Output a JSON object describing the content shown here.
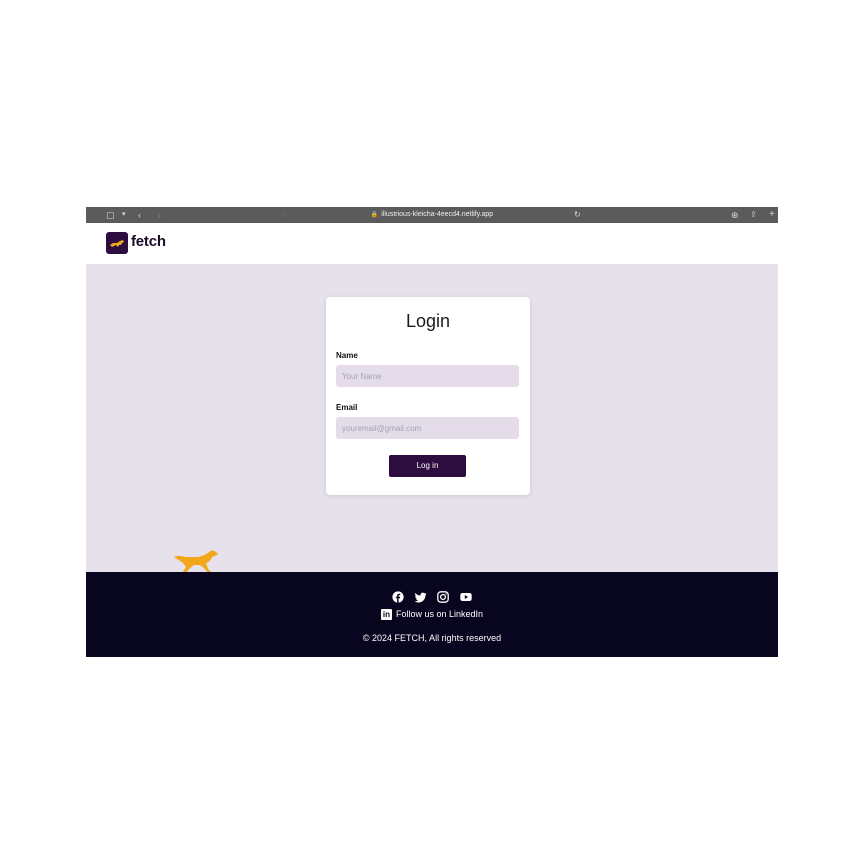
{
  "browser": {
    "url": "illustrious-kleicha-4eecd4.netlify.app"
  },
  "header": {
    "brand": "fetch"
  },
  "login": {
    "title": "Login",
    "name_label": "Name",
    "name_placeholder": "Your Name",
    "name_value": "",
    "email_label": "Email",
    "email_placeholder": "youremail@gmail.com",
    "email_value": "",
    "button_label": "Log in"
  },
  "footer": {
    "social_icons": [
      "facebook-icon",
      "twitter-icon",
      "instagram-icon",
      "youtube-icon"
    ],
    "linkedin_text": "Follow us on LinkedIn",
    "copyright": "© 2024 FETCH, All rights reserved"
  },
  "colors": {
    "brand": "#2d0d3f",
    "page_background": "#e7e1ec",
    "footer_background": "#08061e",
    "dog_accent": "#f2a71b"
  }
}
